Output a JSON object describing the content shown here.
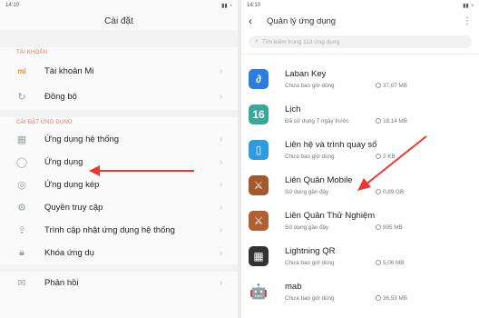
{
  "left": {
    "status_time": "14:10",
    "title": "Cài đặt",
    "section_account": "TÀI KHOẢN",
    "account_items": [
      {
        "label": "Tài khoản Mi"
      },
      {
        "label": "Đồng bộ"
      }
    ],
    "section_apps": "CÀI ĐẶT ỨNG DỤNG",
    "app_items": [
      {
        "label": "Ứng dụng hệ thống"
      },
      {
        "label": "Ứng dụng"
      },
      {
        "label": "Ứng dụng kép"
      },
      {
        "label": "Quyền truy cập"
      },
      {
        "label": "Trình cập nhật ứng dụng hệ thống"
      },
      {
        "label": "Khóa ứng dụ"
      }
    ],
    "feedback": "Phản hồi"
  },
  "right": {
    "status_time": "14:10",
    "title": "Quản lý ứng dụng",
    "search_placeholder": "Tìm kiếm trong 113 ứng dụng",
    "apps": [
      {
        "name": "Laban Key",
        "usage": "Chưa bao giờ dùng",
        "size": "37,07 MB",
        "icon": "laban-key-icon",
        "color": "#2c7fd8",
        "glyph": "∂"
      },
      {
        "name": "Lịch",
        "usage": "Đã sử dụng 7 ngày trước",
        "size": "18,14 MB",
        "icon": "calendar-icon",
        "color": "#3aa79a",
        "glyph": "16"
      },
      {
        "name": "Liên hệ và trình quay số",
        "usage": "Chưa bao giờ dùng",
        "size": "2 KB",
        "icon": "contacts-icon",
        "color": "#2e9be0",
        "glyph": "▯"
      },
      {
        "name": "Liên Quân Mobile",
        "usage": "Sử dụng gần đây",
        "size": "0,89 GB",
        "icon": "lien-quan-icon",
        "color": "#a3582e",
        "glyph": "⚔"
      },
      {
        "name": "Liên Quân Thử Nghiệm",
        "usage": "Sử dụng gần đây",
        "size": "895 MB",
        "icon": "lien-quan-test-icon",
        "color": "#b06034",
        "glyph": "⚔"
      },
      {
        "name": "Lightning QR",
        "usage": "Chưa bao giờ dùng",
        "size": "5,06 MB",
        "icon": "qr-icon",
        "color": "#333333",
        "glyph": "▦"
      },
      {
        "name": "mab",
        "usage": "Chưa bao giờ dùng",
        "size": "36,53 MB",
        "icon": "android-icon",
        "color": "#8bc34a",
        "glyph": "🤖"
      }
    ]
  },
  "colors": {
    "arrow": "#e53935",
    "section": "#e07a5f"
  }
}
